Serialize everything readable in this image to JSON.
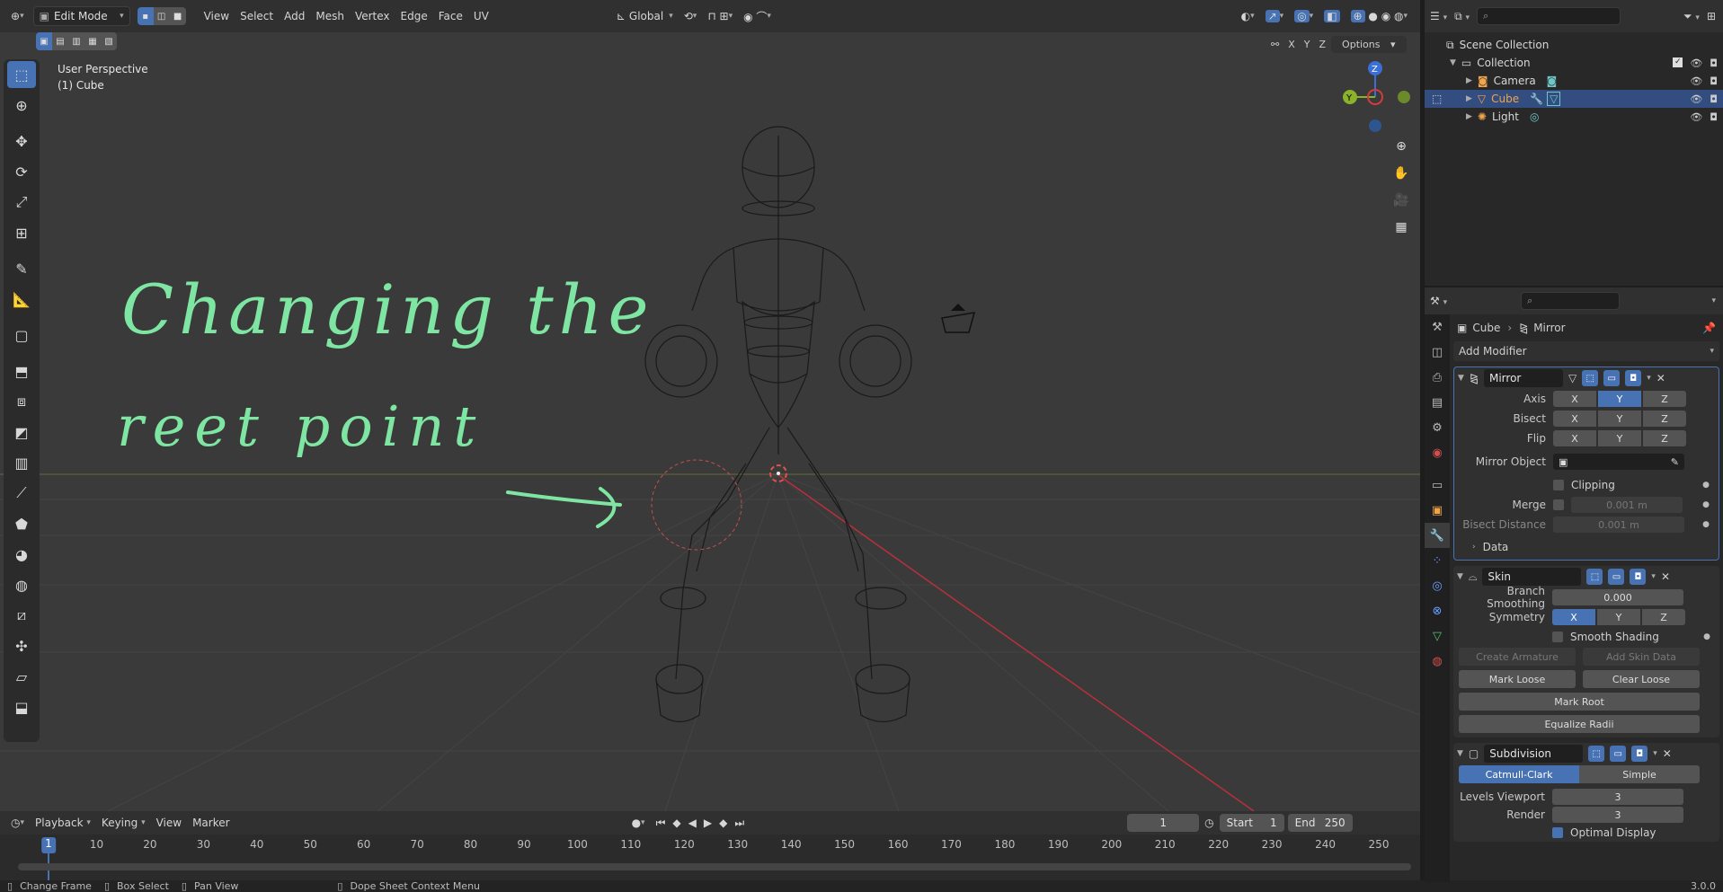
{
  "viewport": {
    "mode": "Edit Mode",
    "menus": [
      "View",
      "Select",
      "Add",
      "Mesh",
      "Vertex",
      "Edge",
      "Face",
      "UV"
    ],
    "orientation": "Global",
    "options_label": "Options",
    "axes": [
      "X",
      "Y",
      "Z"
    ],
    "view_name": "User Perspective",
    "object_name": "(1) Cube",
    "gizmo": {
      "z": "Z",
      "y": "Y",
      "x": "X"
    }
  },
  "annotation": {
    "line1": "Changing the",
    "line2": "reet point"
  },
  "timeline": {
    "menus": [
      "Playback",
      "Keying",
      "View",
      "Marker"
    ],
    "current_frame": "1",
    "start_label": "Start",
    "start": "1",
    "end_label": "End",
    "end": "250",
    "ticks": [
      "1",
      "10",
      "20",
      "30",
      "40",
      "50",
      "60",
      "70",
      "80",
      "90",
      "100",
      "110",
      "120",
      "130",
      "140",
      "150",
      "160",
      "170",
      "180",
      "190",
      "200",
      "210",
      "220",
      "230",
      "240",
      "250"
    ]
  },
  "statusbar": {
    "items": [
      "Change Frame",
      "Box Select",
      "Pan View",
      "Dope Sheet Context Menu"
    ],
    "version": "3.0.0"
  },
  "outliner": {
    "scene": "Scene Collection",
    "collection": "Collection",
    "items": [
      "Camera",
      "Cube",
      "Light"
    ]
  },
  "properties": {
    "breadcrumb_object": "Cube",
    "breadcrumb_modifier": "Mirror",
    "add_modifier": "Add Modifier",
    "mirror": {
      "name": "Mirror",
      "axis_label": "Axis",
      "bisect_label": "Bisect",
      "flip_label": "Flip",
      "mirror_object_label": "Mirror Object",
      "clipping_label": "Clipping",
      "merge_label": "Merge",
      "merge_value": "0.001 m",
      "bisect_distance_label": "Bisect Distance",
      "bisect_distance_value": "0.001 m",
      "data_label": "Data"
    },
    "skin": {
      "name": "Skin",
      "branch_smoothing_label": "Branch Smoothing",
      "branch_smoothing_value": "0.000",
      "symmetry_label": "Symmetry",
      "smooth_shading_label": "Smooth Shading",
      "create_armature": "Create Armature",
      "add_skin_data": "Add Skin Data",
      "mark_loose": "Mark Loose",
      "clear_loose": "Clear Loose",
      "mark_root": "Mark Root",
      "equalize_radii": "Equalize Radii"
    },
    "subdivision": {
      "name": "Subdivision",
      "catmull": "Catmull-Clark",
      "simple": "Simple",
      "levels_viewport_label": "Levels Viewport",
      "levels_viewport": "3",
      "render_label": "Render",
      "render": "3",
      "optimal_display": "Optimal Display"
    }
  },
  "colors": {
    "accent": "#4772b3",
    "annotation": "#7ee6a2",
    "selected_object": "#f0a44b"
  }
}
